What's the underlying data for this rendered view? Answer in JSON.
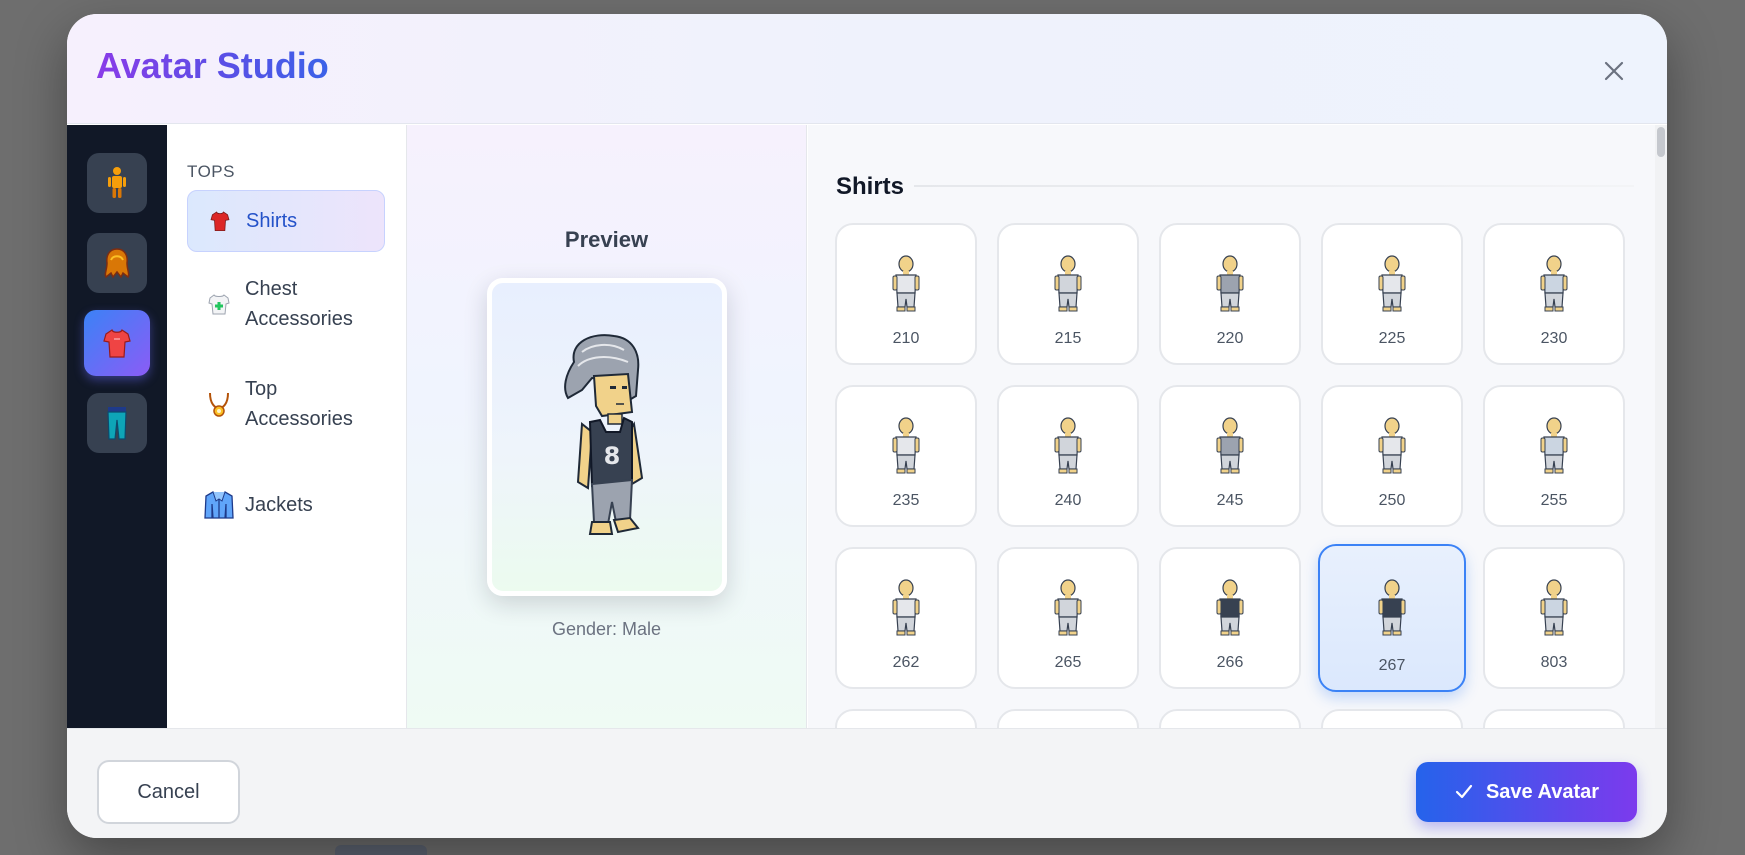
{
  "modal": {
    "title": "Avatar Studio",
    "close_icon": "close-icon"
  },
  "rail": {
    "buttons": [
      {
        "icon": "body-icon",
        "active": false
      },
      {
        "icon": "hair-icon",
        "active": false
      },
      {
        "icon": "shirt-icon",
        "active": true
      },
      {
        "icon": "pants-icon",
        "active": false
      }
    ]
  },
  "categories": {
    "heading": "TOPS",
    "items": [
      {
        "label": "Shirts",
        "icon": "shirt-icon",
        "active": true
      },
      {
        "label": "Chest Accessories",
        "icon": "chest-accessory-icon",
        "active": false
      },
      {
        "label": "Top Accessories",
        "icon": "necklace-icon",
        "active": false
      },
      {
        "label": "Jackets",
        "icon": "jacket-icon",
        "active": false
      }
    ]
  },
  "preview": {
    "title": "Preview",
    "gender": "Gender: Male"
  },
  "items": {
    "heading": "Shirts",
    "cards": [
      {
        "id": "210",
        "selected": false
      },
      {
        "id": "215",
        "selected": false
      },
      {
        "id": "220",
        "selected": false
      },
      {
        "id": "225",
        "selected": false
      },
      {
        "id": "230",
        "selected": false
      },
      {
        "id": "235",
        "selected": false
      },
      {
        "id": "240",
        "selected": false
      },
      {
        "id": "245",
        "selected": false
      },
      {
        "id": "250",
        "selected": false
      },
      {
        "id": "255",
        "selected": false
      },
      {
        "id": "262",
        "selected": false
      },
      {
        "id": "265",
        "selected": false
      },
      {
        "id": "266",
        "selected": false
      },
      {
        "id": "267",
        "selected": true
      },
      {
        "id": "803",
        "selected": false
      }
    ],
    "partial_cards": [
      "",
      "",
      "",
      "",
      ""
    ]
  },
  "footer": {
    "cancel_label": "Cancel",
    "save_label": "Save Avatar"
  },
  "colors": {
    "accent_blue": "#3b82f6",
    "accent_purple": "#8b5cf6",
    "rail_bg": "#111827"
  }
}
